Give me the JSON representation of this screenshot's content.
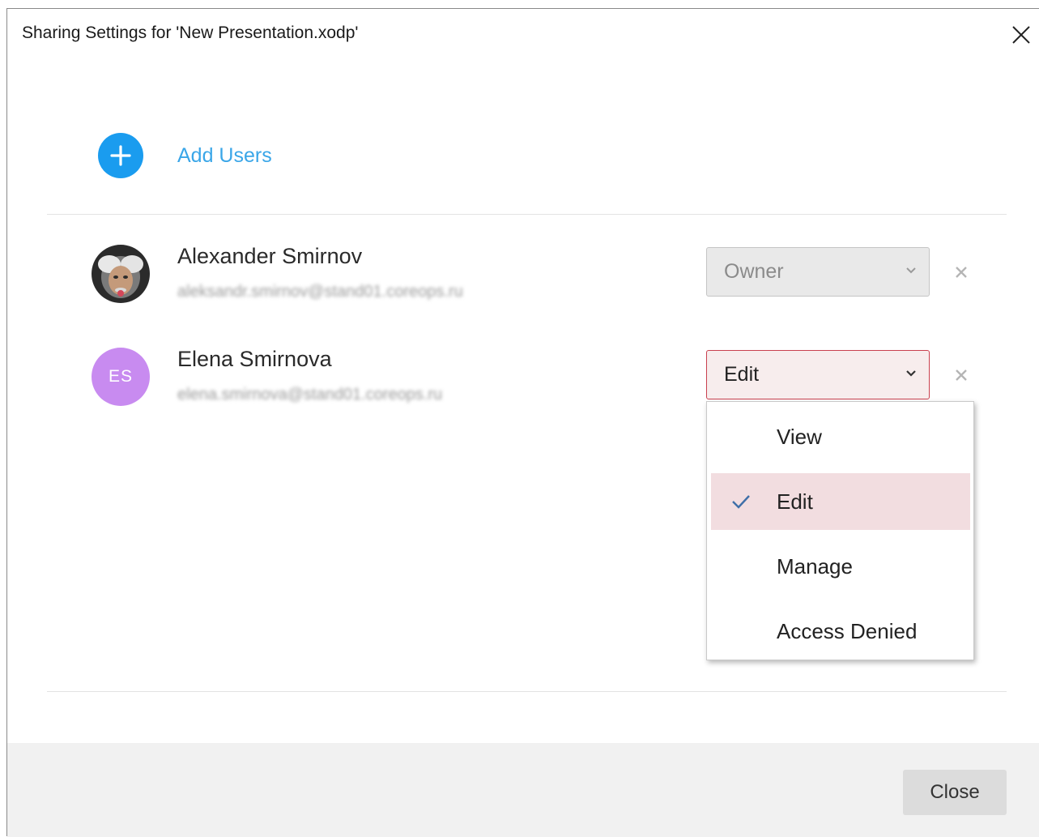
{
  "dialog": {
    "title": "Sharing Settings for 'New Presentation.xodp'",
    "add_users_label": "Add Users",
    "close_label": "Close"
  },
  "users": [
    {
      "name": "Alexander Smirnov",
      "email": "aleksandr.smirnov@stand01.coreops.ru",
      "access": "Owner",
      "avatar": "photo"
    },
    {
      "name": "Elena Smirnova",
      "email": "elena.smirnova@stand01.coreops.ru",
      "access": "Edit",
      "initials": "ES"
    }
  ],
  "access_menu": {
    "options": [
      "View",
      "Edit",
      "Manage",
      "Access Denied"
    ],
    "selected": "Edit"
  },
  "colors": {
    "accent": "#1a9cef",
    "selection": "#f2dde0",
    "focus_border": "#c9404f",
    "initials_avatar": "#c88bf0"
  },
  "icons": [
    "close-icon",
    "plus-icon",
    "chevron-down-icon",
    "remove-icon",
    "check-icon"
  ]
}
